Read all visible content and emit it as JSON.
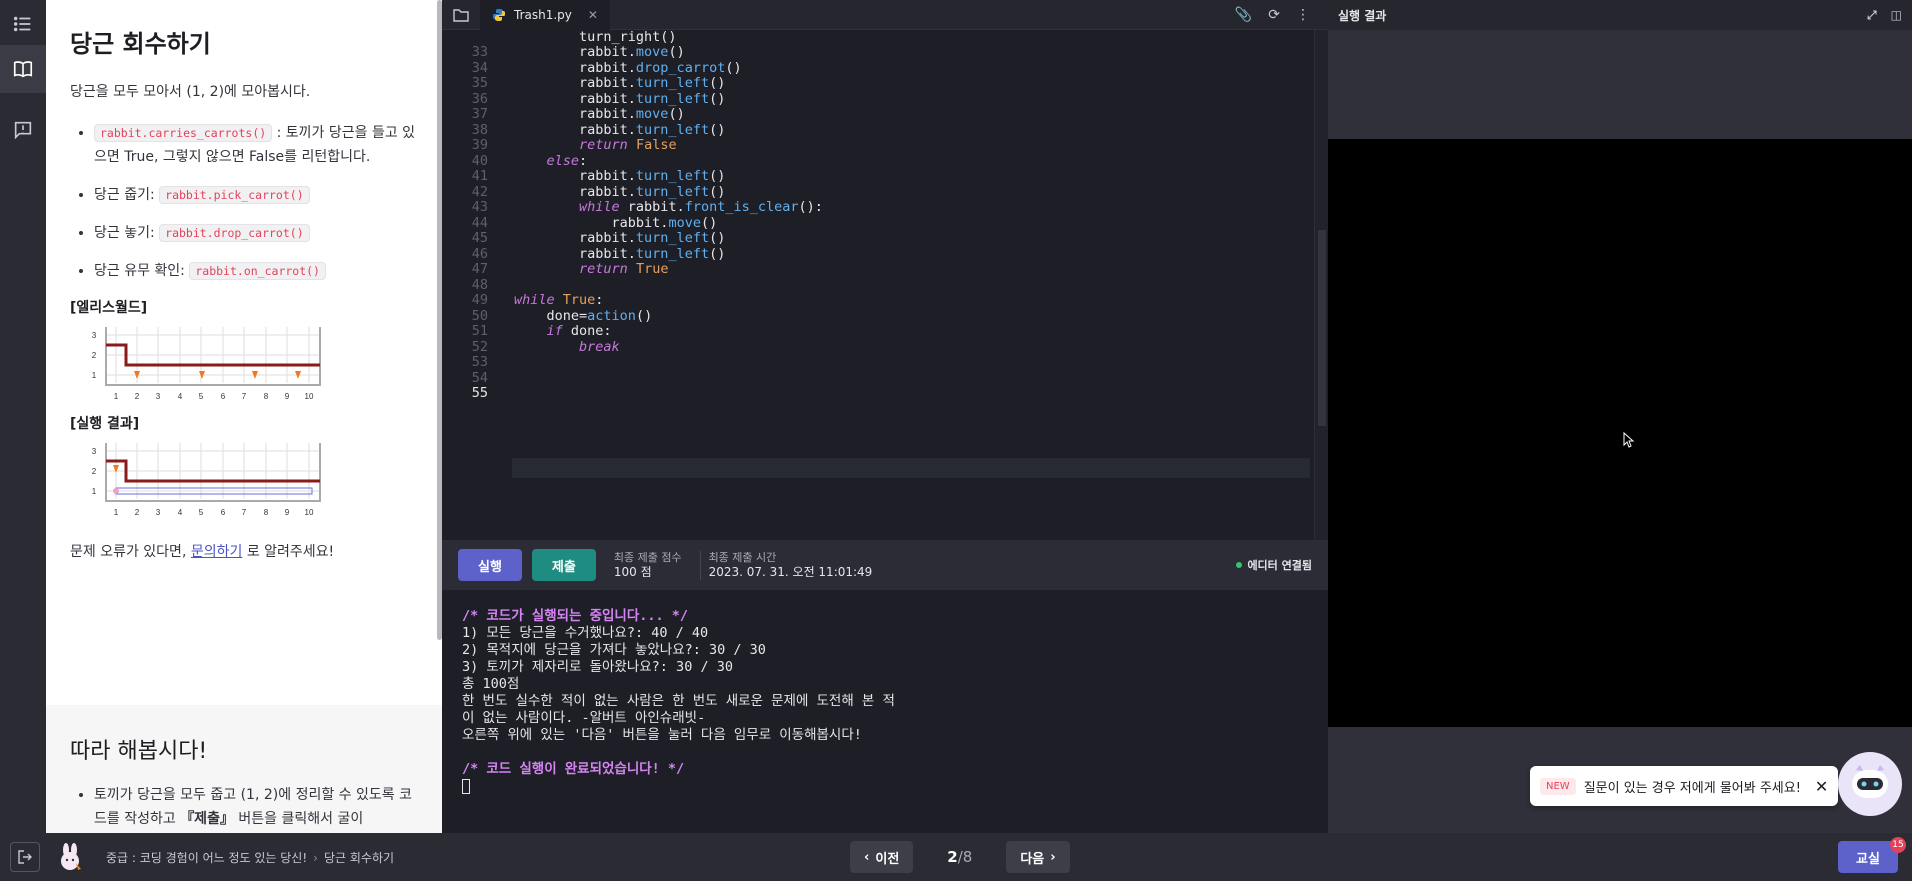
{
  "lesson": {
    "title": "당근 회수하기",
    "intro": "당근을 모두 모아서 (1, 2)에 모아봅시다.",
    "bullets": [
      {
        "code": "rabbit.carries_carrots()",
        "text": " : 토끼가 당근을 들고 있으면 True, 그렇지 않으면 False를 리턴합니다."
      },
      {
        "prefix": "당근 줍기: ",
        "code": "rabbit.pick_carrot()"
      },
      {
        "prefix": "당근 놓기: ",
        "code": "rabbit.drop_carrot()"
      },
      {
        "prefix": "당근 유무 확인: ",
        "code": "rabbit.on_carrot()"
      }
    ],
    "world_heading": "[엘리스월드]",
    "result_heading": "[실행 결과]",
    "x_ticks": [
      "1",
      "2",
      "3",
      "4",
      "5",
      "6",
      "7",
      "8",
      "9",
      "10"
    ],
    "y_ticks": [
      "3",
      "2",
      "1"
    ],
    "help_prefix": "문제 오류가 있다면, ",
    "help_link": "문의하기",
    "help_suffix": " 로 알려주세요!",
    "follow_title": "따라 해봅시다!",
    "follow_text_1": "토끼가 당근을 모두 줍고 (1, 2)에 정리할 수 있도록 코드를 작성하고 ",
    "follow_bold": "『제출』",
    "follow_text_2": " 버튼을 클릭해서 굴이"
  },
  "editor": {
    "tab": "Trash1.py",
    "start_line": 33,
    "first_partial": "        turn_right()",
    "lines": [
      [
        [
          "        rabbit.",
          ""
        ],
        [
          "move",
          "mth"
        ],
        [
          "()",
          ""
        ]
      ],
      [
        [
          "        rabbit.",
          ""
        ],
        [
          "drop_carrot",
          "mth"
        ],
        [
          "()",
          ""
        ]
      ],
      [
        [
          "        rabbit.",
          ""
        ],
        [
          "turn_left",
          "mth"
        ],
        [
          "()",
          ""
        ]
      ],
      [
        [
          "        rabbit.",
          ""
        ],
        [
          "turn_left",
          "mth"
        ],
        [
          "()",
          ""
        ]
      ],
      [
        [
          "        rabbit.",
          ""
        ],
        [
          "move",
          "mth"
        ],
        [
          "()",
          ""
        ]
      ],
      [
        [
          "        rabbit.",
          ""
        ],
        [
          "turn_left",
          "mth"
        ],
        [
          "()",
          ""
        ]
      ],
      [
        [
          "        ",
          ""
        ],
        [
          "return",
          "kw"
        ],
        [
          " ",
          ""
        ],
        [
          "False",
          "bool"
        ]
      ],
      [
        [
          "    ",
          ""
        ],
        [
          "else",
          "kw"
        ],
        [
          ":",
          ""
        ]
      ],
      [
        [
          "        rabbit.",
          ""
        ],
        [
          "turn_left",
          "mth"
        ],
        [
          "()",
          ""
        ]
      ],
      [
        [
          "        rabbit.",
          ""
        ],
        [
          "turn_left",
          "mth"
        ],
        [
          "()",
          ""
        ]
      ],
      [
        [
          "        ",
          ""
        ],
        [
          "while",
          "kw"
        ],
        [
          " rabbit.",
          ""
        ],
        [
          "front_is_clear",
          "mth"
        ],
        [
          "():",
          ""
        ]
      ],
      [
        [
          "            rabbit.",
          ""
        ],
        [
          "move",
          "mth"
        ],
        [
          "()",
          ""
        ]
      ],
      [
        [
          "        rabbit.",
          ""
        ],
        [
          "turn_left",
          "mth"
        ],
        [
          "()",
          ""
        ]
      ],
      [
        [
          "        rabbit.",
          ""
        ],
        [
          "turn_left",
          "mth"
        ],
        [
          "()",
          ""
        ]
      ],
      [
        [
          "        ",
          ""
        ],
        [
          "return",
          "kw"
        ],
        [
          " ",
          ""
        ],
        [
          "True",
          "bool"
        ]
      ],
      [
        [
          "",
          ""
        ]
      ],
      [
        [
          "",
          ""
        ],
        [
          "while",
          "kw"
        ],
        [
          " ",
          ""
        ],
        [
          "True",
          "bool"
        ],
        [
          ":",
          ""
        ]
      ],
      [
        [
          "    done=",
          ""
        ],
        [
          "action",
          "fn"
        ],
        [
          "()",
          ""
        ]
      ],
      [
        [
          "    ",
          ""
        ],
        [
          "if",
          "kw"
        ],
        [
          " done:",
          ""
        ]
      ],
      [
        [
          "        ",
          ""
        ],
        [
          "break",
          "kw"
        ]
      ],
      [
        [
          "",
          ""
        ]
      ],
      [
        [
          "",
          ""
        ]
      ],
      [
        [
          "",
          ""
        ]
      ]
    ]
  },
  "runbar": {
    "run": "실행",
    "submit": "제출",
    "score_label": "최종 제출 점수",
    "score": "100 점",
    "time_label": "최종 제출 시간",
    "time": "2023. 07. 31. 오전 11:01:49",
    "connection": "에디터 연결됨"
  },
  "console": {
    "lines": [
      {
        "t": "/* 코드가 실행되는 중입니다... */",
        "c": true
      },
      {
        "t": "1) 모든 당근을 수거했나요?: 40 / 40"
      },
      {
        "t": "2) 목적지에 당근을 가져다 놓았나요?: 30 / 30"
      },
      {
        "t": "3) 토끼가 제자리로 돌아왔나요?: 30 / 30"
      },
      {
        "t": "총 100점"
      },
      {
        "t": "한 번도 실수한 적이 없는 사람은 한 번도 새로운 문제에 도전해 본 적"
      },
      {
        "t": "이 없는 사람이다. -알버트 아인슈래빗-"
      },
      {
        "t": "오른쪽 위에 있는 '다음' 버튼을 눌러 다음 임무로 이동해봅시다!"
      },
      {
        "t": ""
      },
      {
        "t": "/* 코드 실행이 완료되었습니다! */",
        "c": true
      }
    ]
  },
  "result": {
    "title": "실행 결과"
  },
  "chat": {
    "badge": "NEW",
    "text": "질문이 있는 경우 저에게 물어봐 주세요!"
  },
  "bottom": {
    "crumb_1": "중급 : 코딩 경험이 어느 정도 있는 당신!",
    "crumb_2": "당근 회수하기",
    "prev": "이전",
    "next": "다음",
    "page_current": "2",
    "page_total": "/8",
    "classroom": "교실",
    "classroom_badge": "15"
  },
  "colors": {
    "accent": "#5c62c9",
    "submit": "#1f8c82",
    "wall": "#8b1a1a",
    "carrot": "#f07a22"
  },
  "icons": [
    "list-icon",
    "book-icon",
    "feedback-icon",
    "folder-icon",
    "python-icon",
    "close-icon",
    "clip-icon",
    "refresh-icon",
    "more-icon",
    "expand-icon",
    "split-icon",
    "exit-icon",
    "chevron-left-icon",
    "chevron-right-icon"
  ]
}
